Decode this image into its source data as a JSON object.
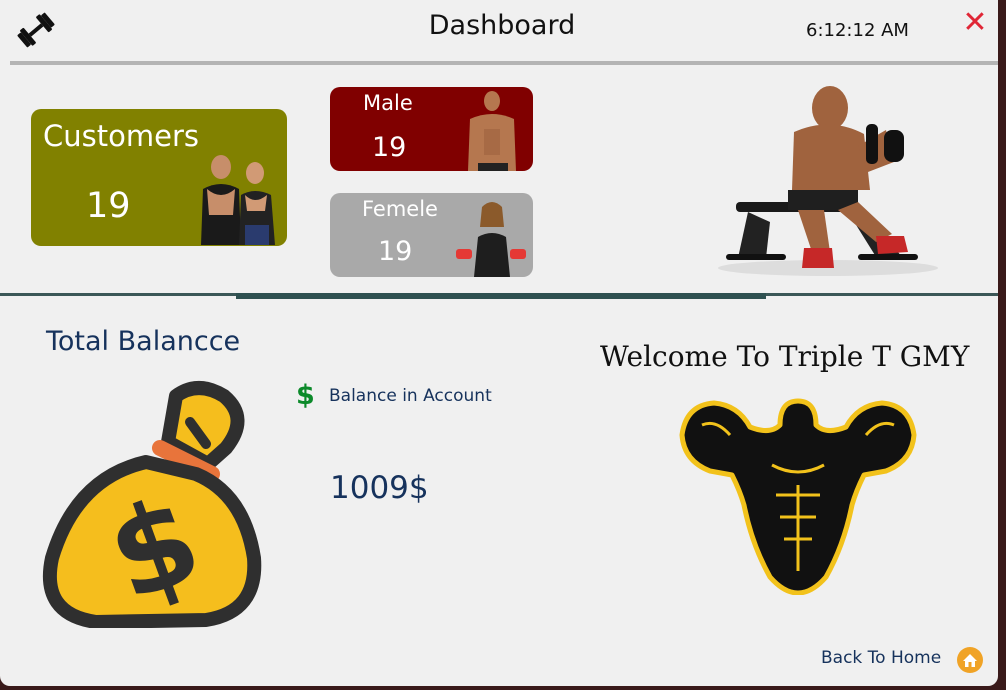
{
  "window": {
    "title": "Dashboard",
    "clock": "6:12:12 AM",
    "close_glyph": "✕",
    "app_icon": "dumbbell-icon"
  },
  "cards": {
    "customers": {
      "label": "Customers",
      "count": "19",
      "color": "#818100"
    },
    "male": {
      "label": "Male",
      "count": "19",
      "color": "#800000"
    },
    "female": {
      "label": "Femele",
      "count": "19",
      "color": "#a9a9a9"
    }
  },
  "balance": {
    "title": "Total Balancce",
    "account_label": "Balance in Account",
    "value": "1009$",
    "currency_icon": "$"
  },
  "welcome": {
    "text": "Welcome To Triple T GMY"
  },
  "footer": {
    "back_home": "Back To Home",
    "home_icon": "home-icon"
  },
  "colors": {
    "accent_navy": "#16325c",
    "close_red": "#e02636",
    "dollar_green": "#0c8a2a",
    "bag_yellow": "#f5be1d"
  }
}
